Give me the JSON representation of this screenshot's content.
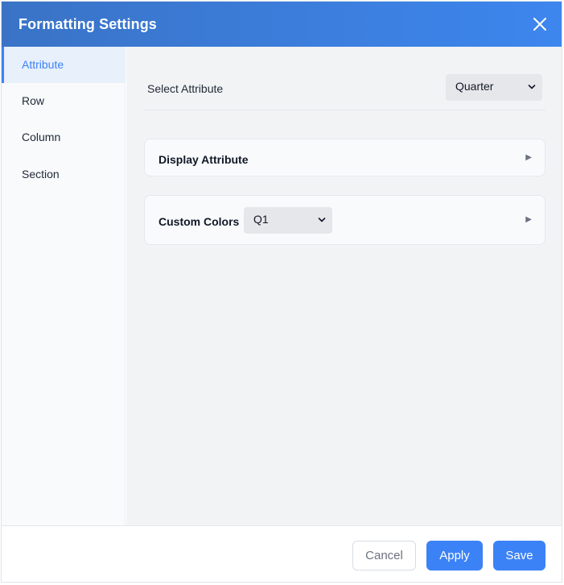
{
  "dialog": {
    "title": "Formatting Settings",
    "close_icon": "close-icon"
  },
  "sidebar": {
    "items": [
      {
        "label": "Attribute",
        "active": true
      },
      {
        "label": "Row",
        "active": false
      },
      {
        "label": "Column",
        "active": false
      },
      {
        "label": "Section",
        "active": false
      }
    ]
  },
  "main": {
    "select_attribute": {
      "label": "Select Attribute",
      "value": "Quarter",
      "icon": "chevron-down-icon"
    },
    "display_attribute": {
      "title": "Display Attribute",
      "arrow": "▶"
    },
    "custom_colors": {
      "title": "Custom Colors",
      "value": "Q1",
      "arrow": "▶",
      "icon": "chevron-down-icon"
    }
  },
  "footer": {
    "cancel_label": "Cancel",
    "apply_label": "Apply",
    "save_label": "Save"
  },
  "colors": {
    "accent": "#3b82f6",
    "header_gradient_start": "#3a73c6",
    "header_gradient_end": "#3d86ee"
  }
}
